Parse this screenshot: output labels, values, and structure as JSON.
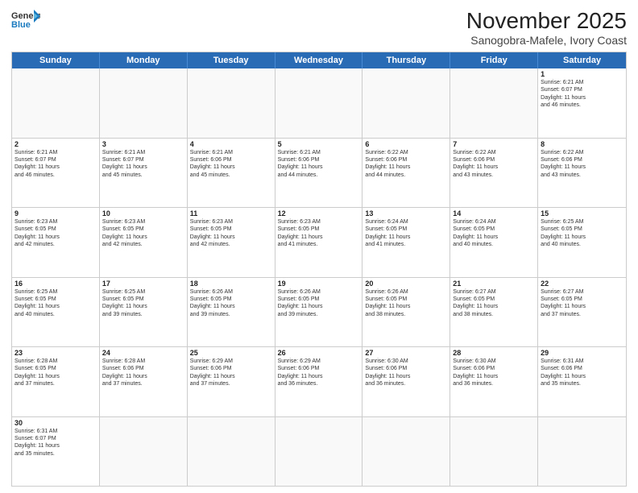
{
  "header": {
    "logo_general": "General",
    "logo_blue": "Blue",
    "month": "November 2025",
    "location": "Sanogobra-Mafele, Ivory Coast"
  },
  "weekdays": [
    "Sunday",
    "Monday",
    "Tuesday",
    "Wednesday",
    "Thursday",
    "Friday",
    "Saturday"
  ],
  "rows": [
    [
      {
        "day": "",
        "info": ""
      },
      {
        "day": "",
        "info": ""
      },
      {
        "day": "",
        "info": ""
      },
      {
        "day": "",
        "info": ""
      },
      {
        "day": "",
        "info": ""
      },
      {
        "day": "",
        "info": ""
      },
      {
        "day": "1",
        "info": "Sunrise: 6:21 AM\nSunset: 6:07 PM\nDaylight: 11 hours\nand 46 minutes."
      }
    ],
    [
      {
        "day": "2",
        "info": "Sunrise: 6:21 AM\nSunset: 6:07 PM\nDaylight: 11 hours\nand 46 minutes."
      },
      {
        "day": "3",
        "info": "Sunrise: 6:21 AM\nSunset: 6:07 PM\nDaylight: 11 hours\nand 45 minutes."
      },
      {
        "day": "4",
        "info": "Sunrise: 6:21 AM\nSunset: 6:06 PM\nDaylight: 11 hours\nand 45 minutes."
      },
      {
        "day": "5",
        "info": "Sunrise: 6:21 AM\nSunset: 6:06 PM\nDaylight: 11 hours\nand 44 minutes."
      },
      {
        "day": "6",
        "info": "Sunrise: 6:22 AM\nSunset: 6:06 PM\nDaylight: 11 hours\nand 44 minutes."
      },
      {
        "day": "7",
        "info": "Sunrise: 6:22 AM\nSunset: 6:06 PM\nDaylight: 11 hours\nand 43 minutes."
      },
      {
        "day": "8",
        "info": "Sunrise: 6:22 AM\nSunset: 6:06 PM\nDaylight: 11 hours\nand 43 minutes."
      }
    ],
    [
      {
        "day": "9",
        "info": "Sunrise: 6:23 AM\nSunset: 6:05 PM\nDaylight: 11 hours\nand 42 minutes."
      },
      {
        "day": "10",
        "info": "Sunrise: 6:23 AM\nSunset: 6:05 PM\nDaylight: 11 hours\nand 42 minutes."
      },
      {
        "day": "11",
        "info": "Sunrise: 6:23 AM\nSunset: 6:05 PM\nDaylight: 11 hours\nand 42 minutes."
      },
      {
        "day": "12",
        "info": "Sunrise: 6:23 AM\nSunset: 6:05 PM\nDaylight: 11 hours\nand 41 minutes."
      },
      {
        "day": "13",
        "info": "Sunrise: 6:24 AM\nSunset: 6:05 PM\nDaylight: 11 hours\nand 41 minutes."
      },
      {
        "day": "14",
        "info": "Sunrise: 6:24 AM\nSunset: 6:05 PM\nDaylight: 11 hours\nand 40 minutes."
      },
      {
        "day": "15",
        "info": "Sunrise: 6:25 AM\nSunset: 6:05 PM\nDaylight: 11 hours\nand 40 minutes."
      }
    ],
    [
      {
        "day": "16",
        "info": "Sunrise: 6:25 AM\nSunset: 6:05 PM\nDaylight: 11 hours\nand 40 minutes."
      },
      {
        "day": "17",
        "info": "Sunrise: 6:25 AM\nSunset: 6:05 PM\nDaylight: 11 hours\nand 39 minutes."
      },
      {
        "day": "18",
        "info": "Sunrise: 6:26 AM\nSunset: 6:05 PM\nDaylight: 11 hours\nand 39 minutes."
      },
      {
        "day": "19",
        "info": "Sunrise: 6:26 AM\nSunset: 6:05 PM\nDaylight: 11 hours\nand 39 minutes."
      },
      {
        "day": "20",
        "info": "Sunrise: 6:26 AM\nSunset: 6:05 PM\nDaylight: 11 hours\nand 38 minutes."
      },
      {
        "day": "21",
        "info": "Sunrise: 6:27 AM\nSunset: 6:05 PM\nDaylight: 11 hours\nand 38 minutes."
      },
      {
        "day": "22",
        "info": "Sunrise: 6:27 AM\nSunset: 6:05 PM\nDaylight: 11 hours\nand 37 minutes."
      }
    ],
    [
      {
        "day": "23",
        "info": "Sunrise: 6:28 AM\nSunset: 6:05 PM\nDaylight: 11 hours\nand 37 minutes."
      },
      {
        "day": "24",
        "info": "Sunrise: 6:28 AM\nSunset: 6:06 PM\nDaylight: 11 hours\nand 37 minutes."
      },
      {
        "day": "25",
        "info": "Sunrise: 6:29 AM\nSunset: 6:06 PM\nDaylight: 11 hours\nand 37 minutes."
      },
      {
        "day": "26",
        "info": "Sunrise: 6:29 AM\nSunset: 6:06 PM\nDaylight: 11 hours\nand 36 minutes."
      },
      {
        "day": "27",
        "info": "Sunrise: 6:30 AM\nSunset: 6:06 PM\nDaylight: 11 hours\nand 36 minutes."
      },
      {
        "day": "28",
        "info": "Sunrise: 6:30 AM\nSunset: 6:06 PM\nDaylight: 11 hours\nand 36 minutes."
      },
      {
        "day": "29",
        "info": "Sunrise: 6:31 AM\nSunset: 6:06 PM\nDaylight: 11 hours\nand 35 minutes."
      }
    ],
    [
      {
        "day": "30",
        "info": "Sunrise: 6:31 AM\nSunset: 6:07 PM\nDaylight: 11 hours\nand 35 minutes."
      },
      {
        "day": "",
        "info": ""
      },
      {
        "day": "",
        "info": ""
      },
      {
        "day": "",
        "info": ""
      },
      {
        "day": "",
        "info": ""
      },
      {
        "day": "",
        "info": ""
      },
      {
        "day": "",
        "info": ""
      }
    ]
  ]
}
